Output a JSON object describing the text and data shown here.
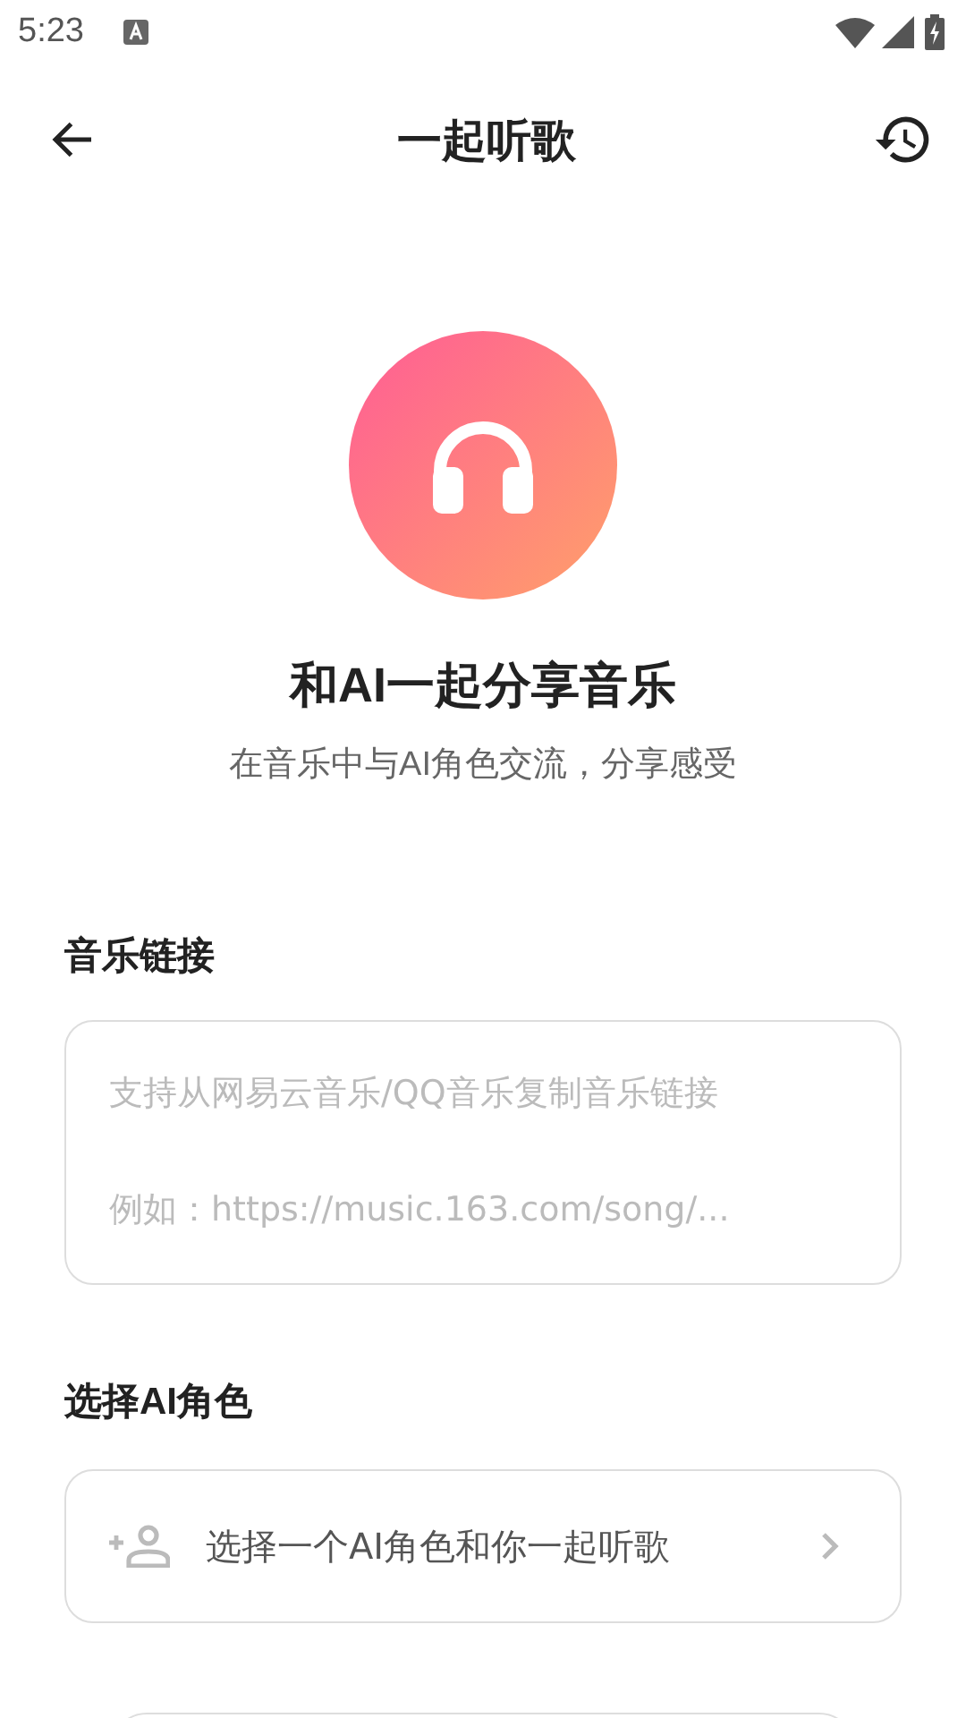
{
  "status_bar": {
    "time": "5:23"
  },
  "header": {
    "title": "一起听歌"
  },
  "hero": {
    "title": "和AI一起分享音乐",
    "subtitle": "在音乐中与AI角色交流，分享感受"
  },
  "link_section": {
    "label": "音乐链接",
    "placeholder": [
      "支持从网易云音乐/QQ音乐复制音乐链接",
      "例如：https://music.163.com/song/..."
    ]
  },
  "role_section": {
    "label": "选择AI角色",
    "selector": "选择一个AI角色和你一起听歌"
  }
}
